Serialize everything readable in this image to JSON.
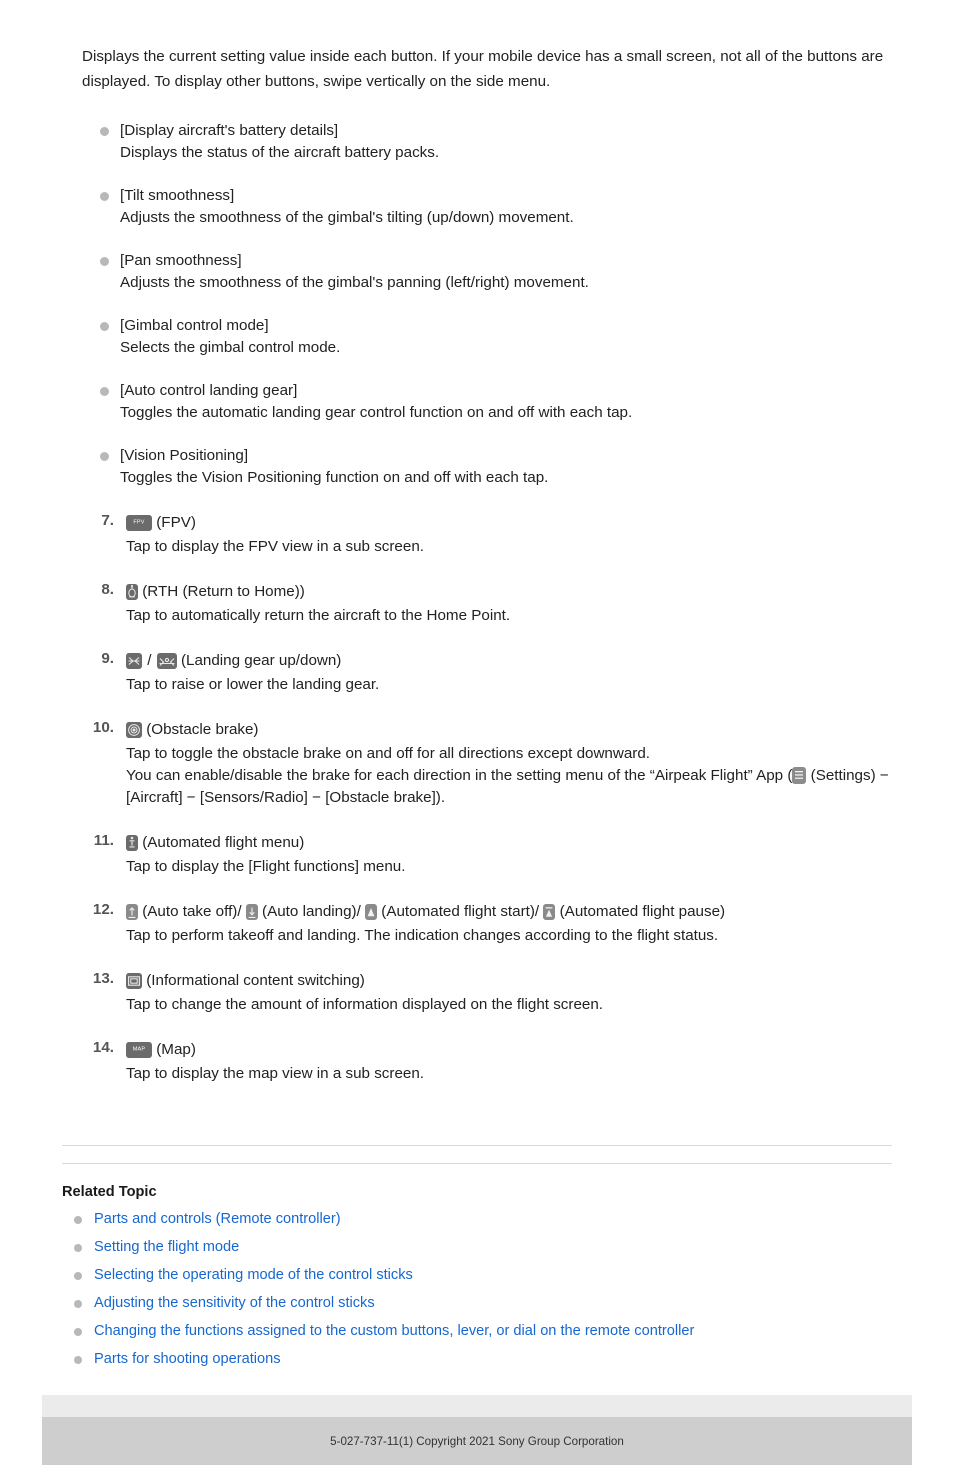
{
  "intro": "Displays the current setting value inside each button. If your mobile device has a small screen, not all of the buttons are displayed. To display other buttons, swipe vertically on the side menu.",
  "bullets": [
    {
      "title": "[Display aircraft's battery details]",
      "desc": "Displays the status of the aircraft battery packs."
    },
    {
      "title": "[Tilt smoothness]",
      "desc": "Adjusts the smoothness of the gimbal's tilting (up/down) movement."
    },
    {
      "title": "[Pan smoothness]",
      "desc": "Adjusts the smoothness of the gimbal's panning (left/right) movement."
    },
    {
      "title": "[Gimbal control mode]",
      "desc": "Selects the gimbal control mode."
    },
    {
      "title": "[Auto control landing gear]",
      "desc": "Toggles the automatic landing gear control function on and off with each tap."
    },
    {
      "title": "[Vision Positioning]",
      "desc": "Toggles the Vision Positioning function on and off with each tap."
    }
  ],
  "steps": {
    "s7": {
      "num": "7.",
      "icon_label": "FPV",
      "label": "(FPV)",
      "body": "Tap to display the FPV view in a sub screen."
    },
    "s8": {
      "num": "8.",
      "label": "(RTH (Return to Home))",
      "body": "Tap to automatically return the aircraft to the Home Point."
    },
    "s9": {
      "num": "9.",
      "separator": "/",
      "label": "(Landing gear up/down)",
      "body": "Tap to raise or lower the landing gear."
    },
    "s10": {
      "num": "10.",
      "label": "(Obstacle brake)",
      "body_line1": "Tap to toggle the obstacle brake on and off for all directions except downward.",
      "body_line2_a": "You can enable/disable the brake for each direction in the setting menu of the “Airpeak Flight” App (",
      "body_line2_b": " (Settings) −",
      "body_line3": "[Aircraft] − [Sensors/Radio] − [Obstacle brake])."
    },
    "s11": {
      "num": "11.",
      "label": "(Automated flight menu)",
      "body": "Tap to display the [Flight functions] menu."
    },
    "s12": {
      "num": "12.",
      "label_a": "(Auto take off)/",
      "label_b": "(Auto landing)/",
      "label_c": "(Automated flight start)/",
      "label_d": "(Automated flight pause)",
      "body": "Tap to perform takeoff and landing. The indication changes according to the flight status."
    },
    "s13": {
      "num": "13.",
      "label": "(Informational content switching)",
      "body": "Tap to change the amount of information displayed on the flight screen."
    },
    "s14": {
      "num": "14.",
      "icon_label": "MAP",
      "label": "(Map)",
      "body": "Tap to display the map view in a sub screen."
    }
  },
  "related": {
    "title": "Related Topic",
    "links": [
      "Parts and controls (Remote controller)",
      "Setting the flight mode",
      "Selecting the operating mode of the control sticks",
      "Adjusting the sensitivity of the control sticks",
      "Changing the functions assigned to the custom buttons, lever, or dial on the remote controller",
      "Parts for shooting operations"
    ]
  },
  "footer": {
    "text": "5-027-737-11(1) Copyright 2021 Sony Group Corporation"
  },
  "colors": {
    "link": "#1667d1",
    "icon_dark": "#6b6b6b",
    "icon_light": "#8a8a8a",
    "bullet": "#b8b8b8",
    "footer_bar": "#cecece",
    "footer_spacer": "#ebebeb"
  }
}
